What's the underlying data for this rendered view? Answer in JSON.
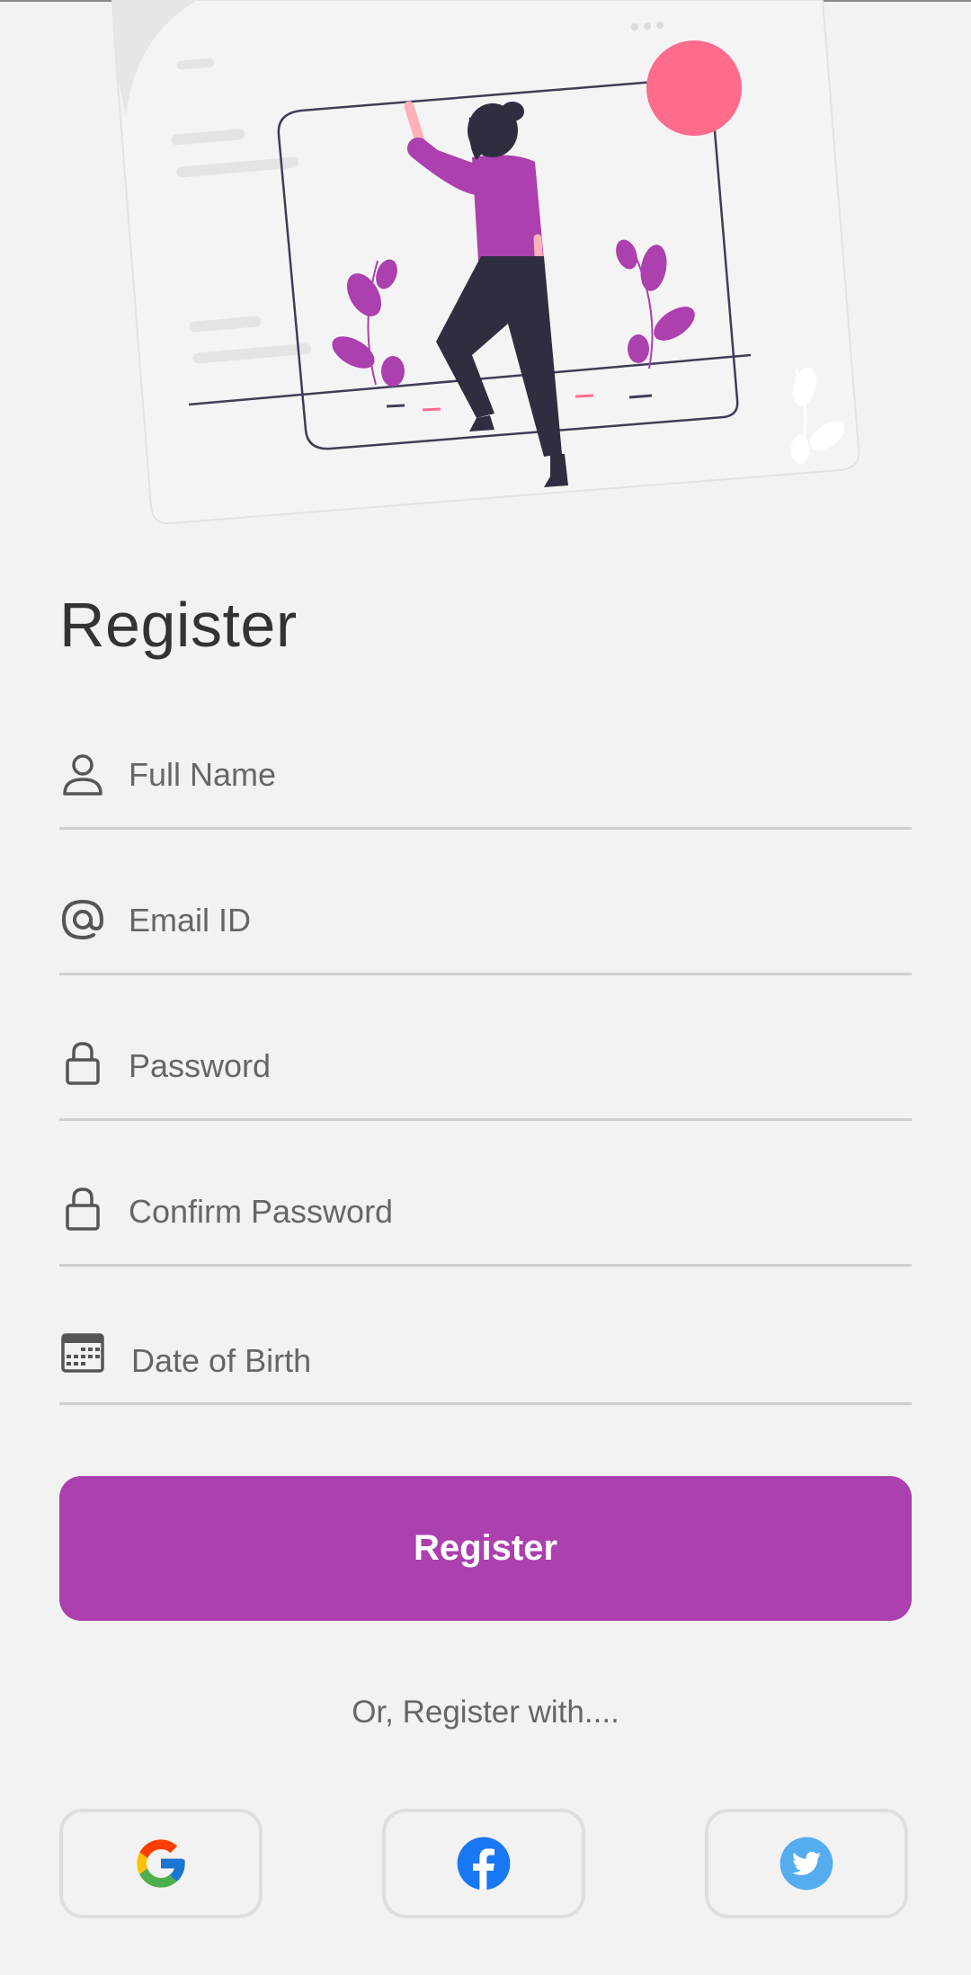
{
  "page": {
    "title": "Register"
  },
  "form": {
    "full_name_placeholder": "Full Name",
    "email_placeholder": "Email ID",
    "password_placeholder": "Password",
    "confirm_password_placeholder": "Confirm Password",
    "dob_placeholder": "Date of Birth"
  },
  "actions": {
    "register_label": "Register",
    "alt_register_text": "Or, Register with...."
  },
  "social": [
    "google-icon",
    "facebook-icon",
    "twitter-icon"
  ],
  "colors": {
    "accent": "#ab40ae",
    "background": "#f2f2f2",
    "sun": "#ff6b8b",
    "figure_dark": "#2f2e41",
    "facebook": "#1877f2",
    "twitter": "#55acee"
  }
}
